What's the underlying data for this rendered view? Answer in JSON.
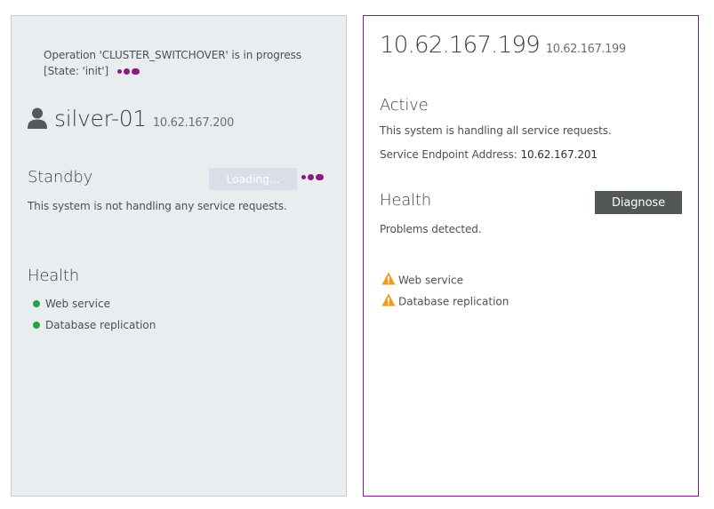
{
  "standby_panel": {
    "operation_text": "Operation 'CLUSTER_SWITCHOVER' is in progress",
    "state_text": "[State: 'init']",
    "host_name": "silver-01",
    "host_ip": "10.62.167.200",
    "role_title": "Standby",
    "loading_label": "Loading...",
    "role_description": "This system is not handling any service requests.",
    "health_title": "Health",
    "health_items": [
      {
        "label": "Web service",
        "status": "ok"
      },
      {
        "label": "Database replication",
        "status": "ok"
      }
    ],
    "status_color": "#23a04a",
    "spinner_color": "#8a1b7f"
  },
  "active_panel": {
    "host_ip_large": "10.62.167.199",
    "host_ip_small": "10.62.167.199",
    "role_title": "Active",
    "role_description": "This system is handling all service requests.",
    "endpoint_label": "Service Endpoint Address:",
    "endpoint_value": "10.62.167.201",
    "health_title": "Health",
    "diagnose_label": "Diagnose",
    "health_summary": "Problems detected.",
    "health_items": [
      {
        "label": "Web service",
        "status": "warning"
      },
      {
        "label": "Database replication",
        "status": "warning"
      }
    ],
    "warning_color": "#f09a19",
    "border_color": "#7b1f84"
  }
}
